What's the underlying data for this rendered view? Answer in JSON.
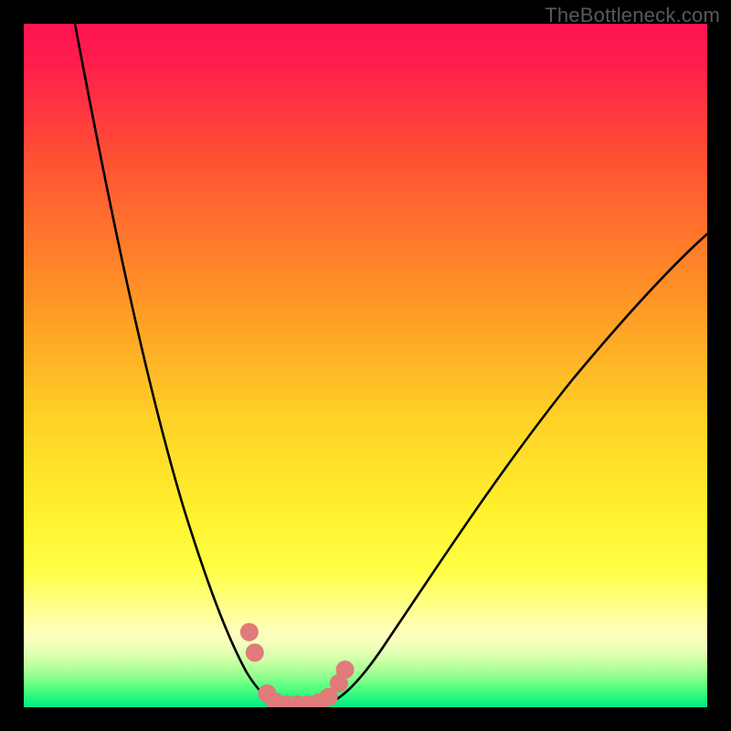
{
  "watermark": "TheBottleneck.com",
  "colors": {
    "page_bg": "#000000",
    "marker_fill": "#df7b79",
    "curve_stroke": "#000000",
    "gradient_top": "#ff1452",
    "gradient_mid_orange": "#ff9426",
    "gradient_yellow": "#fff22e",
    "gradient_green": "#15f57d"
  },
  "chart_data": {
    "type": "line",
    "title": "",
    "xlabel": "",
    "ylabel": "",
    "ylim": [
      0,
      100
    ],
    "xlim": [
      0,
      100
    ],
    "description": "Bottleneck V-curve: two curves descend to near-zero (optimal) at approx x≈37-44 then rise again; background gradient encodes severity (red=high, green=low).",
    "series": [
      {
        "name": "left-branch",
        "x": [
          7.5,
          12,
          17,
          23,
          30,
          33,
          35.5,
          37.2
        ],
        "y": [
          100,
          78,
          55,
          30,
          8,
          4,
          1.3,
          0.5
        ]
      },
      {
        "name": "right-branch",
        "x": [
          44.1,
          47,
          54,
          64,
          80,
          100
        ],
        "y": [
          0.5,
          3,
          10,
          24,
          48,
          70
        ]
      }
    ],
    "markers": [
      {
        "x": 33.0,
        "y": 11.0
      },
      {
        "x": 33.8,
        "y": 8.0
      },
      {
        "x": 35.6,
        "y": 2.0
      },
      {
        "x": 36.8,
        "y": 0.8
      },
      {
        "x": 38.4,
        "y": 0.4
      },
      {
        "x": 40.0,
        "y": 0.4
      },
      {
        "x": 41.6,
        "y": 0.4
      },
      {
        "x": 43.2,
        "y": 0.7
      },
      {
        "x": 44.6,
        "y": 1.5
      },
      {
        "x": 46.1,
        "y": 3.5
      },
      {
        "x": 47.0,
        "y": 5.5
      }
    ],
    "marker_radius_px": 10
  }
}
